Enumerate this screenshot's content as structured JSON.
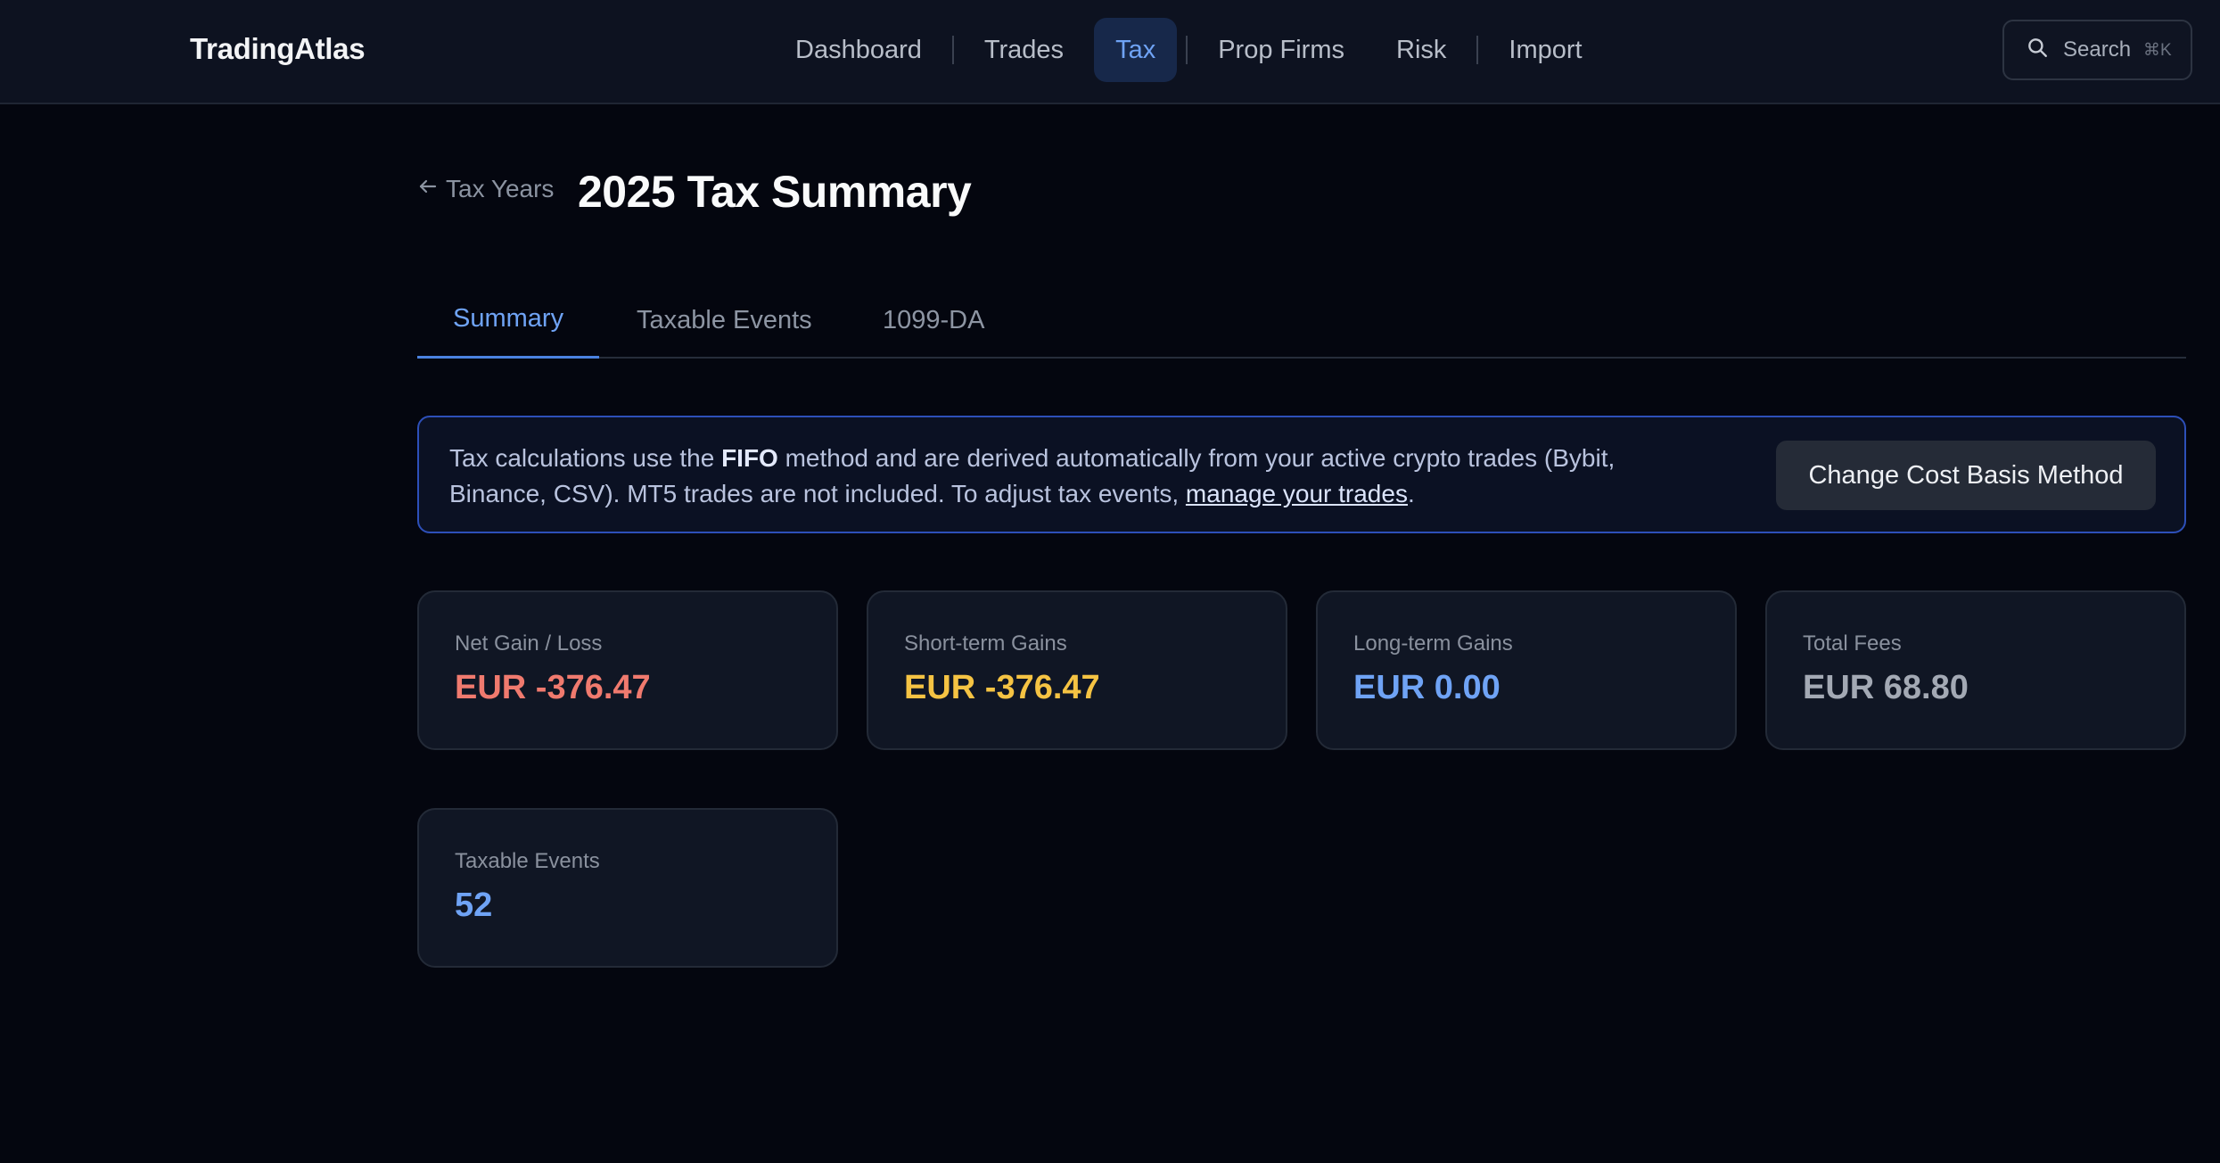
{
  "app": {
    "brand": "TradingAtlas"
  },
  "nav": {
    "items": [
      {
        "label": "Dashboard"
      },
      {
        "label": "Trades"
      },
      {
        "label": "Tax"
      },
      {
        "label": "Prop Firms"
      },
      {
        "label": "Risk"
      },
      {
        "label": "Import"
      }
    ],
    "active": "Tax"
  },
  "search": {
    "label": "Search",
    "shortcut": "⌘K"
  },
  "header": {
    "back_label": "Tax Years",
    "title": "2025 Tax Summary"
  },
  "tabs": [
    {
      "label": "Summary"
    },
    {
      "label": "Taxable Events"
    },
    {
      "label": "1099-DA"
    }
  ],
  "banner": {
    "text_1": "Tax calculations use the ",
    "method": "FIFO",
    "text_2": " method and are derived automatically from your active crypto trades (Bybit, Binance, CSV). MT5 trades are not included. To adjust tax events, ",
    "link": "manage your trades",
    "text_3": ".",
    "button_label": "Change Cost Basis Method"
  },
  "stats": [
    {
      "label": "Net Gain / Loss",
      "value": "EUR -376.47",
      "color": "#f07a6e"
    },
    {
      "label": "Short-term Gains",
      "value": "EUR -376.47",
      "color": "#f5c343"
    },
    {
      "label": "Long-term Gains",
      "value": "EUR 0.00",
      "color": "#6fa3f5"
    },
    {
      "label": "Total Fees",
      "value": "EUR 68.80",
      "color": "#a3a9b4"
    },
    {
      "label": "Taxable Events",
      "value": "52",
      "color": "#6fa3f5"
    }
  ],
  "colors": {
    "accent": "#6fa3f5",
    "banner_border": "#2d4fb8",
    "background": "#04060f"
  }
}
